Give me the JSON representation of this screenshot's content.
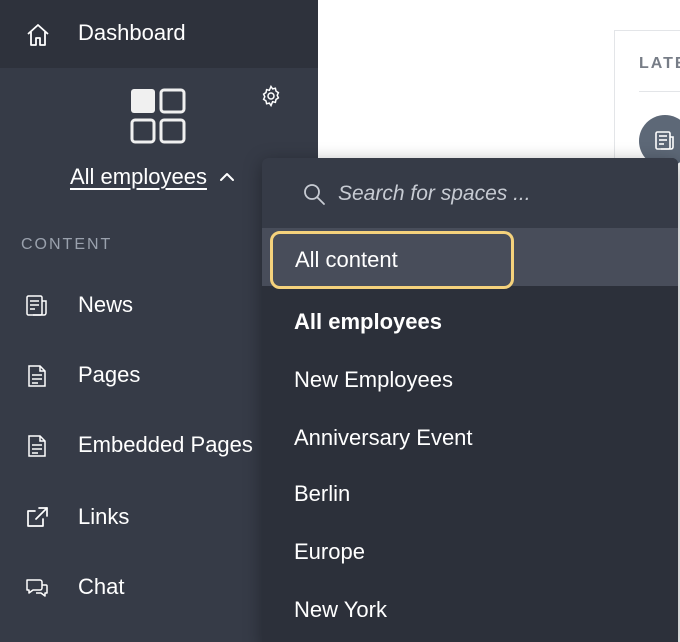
{
  "sidebar": {
    "dashboard_label": "Dashboard",
    "current_space": "All employees",
    "section_title": "CONTENT",
    "items": [
      {
        "label": "News",
        "icon": "news-icon"
      },
      {
        "label": "Pages",
        "icon": "page-icon"
      },
      {
        "label": "Embedded Pages",
        "icon": "embedded-page-icon"
      },
      {
        "label": "Links",
        "icon": "external-link-icon"
      },
      {
        "label": "Chat",
        "icon": "chat-icon"
      }
    ]
  },
  "main": {
    "section_label": "LATE"
  },
  "dropdown": {
    "search_placeholder": "Search for spaces ...",
    "options": [
      {
        "label": "All content",
        "selected": true
      },
      {
        "label": "All employees",
        "bold": true
      },
      {
        "label": "New Employees"
      },
      {
        "label": "Anniversary Event"
      },
      {
        "label": "Berlin"
      },
      {
        "label": "Europe"
      },
      {
        "label": "New York"
      }
    ]
  },
  "colors": {
    "sidebar_bg": "#363b47",
    "dashboard_bg": "#2e323c",
    "dropdown_bg": "#2c303a",
    "highlight_border": "#f5d27c",
    "muted_text": "#9aa1ad"
  }
}
